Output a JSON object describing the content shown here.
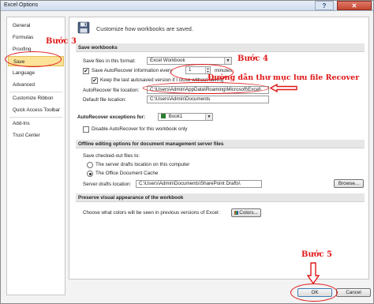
{
  "window": {
    "title": "Excel Options",
    "help_glyph": "?",
    "close_glyph": "✕"
  },
  "sidebar": {
    "items": [
      {
        "label": "General"
      },
      {
        "label": "Formulas"
      },
      {
        "label": "Proofing"
      },
      {
        "label": "Save",
        "selected": true
      },
      {
        "label": "Language"
      },
      {
        "label": "Advanced"
      },
      {
        "label": "Customize Ribbon"
      },
      {
        "label": "Quick Access Toolbar"
      },
      {
        "label": "Add-Ins"
      },
      {
        "label": "Trust Center"
      }
    ]
  },
  "header": {
    "text": "Customize how workbooks are saved.",
    "icon": "floppy-disk-icon"
  },
  "save_workbooks": {
    "section_title": "Save workbooks",
    "format_label": "Save files in this format:",
    "format_value": "Excel Workbook",
    "autorecover_label": "Save AutoRecover information every",
    "autorecover_checked": true,
    "autorecover_minutes": "1",
    "minutes_label": "minutes",
    "keep_last_label": "Keep the last autosaved version if I close without saving",
    "keep_last_checked": true,
    "autorecover_location_label": "AutoRecover file location:",
    "autorecover_location_value": "C:\\Users\\Admin\\AppData\\Roaming\\Microsoft\\Excel\\",
    "default_location_label": "Default file location:",
    "default_location_value": "C:\\Users\\Admin\\Documents"
  },
  "autorecover_exceptions": {
    "label": "AutoRecover exceptions for:",
    "workbook_value": "Book1",
    "disable_label": "Disable AutoRecover for this workbook only",
    "disable_checked": false
  },
  "offline_editing": {
    "section_title": "Offline editing options for document management server files",
    "checkout_label": "Save checked-out files to:",
    "option_server": "The server drafts location on this computer",
    "option_cache": "The Office Document Cache",
    "drafts_label": "Server drafts location:",
    "drafts_value": "C:\\Users\\Admin\\Documents\\SharePoint Drafts\\",
    "browse_label": "Browse..."
  },
  "preserve_visual": {
    "section_title": "Preserve visual appearance of the workbook",
    "colors_label": "Choose what colors will be seen in previous versions of Excel:",
    "colors_button": "Colors..."
  },
  "footer": {
    "ok_label": "OK",
    "cancel_label": "Cancel"
  },
  "annotations": {
    "step3": "Bước 3",
    "step4": "Bước 4",
    "step5": "Bước 5",
    "recover_path_note": "Đường dẫn thư mục lưu file Recover",
    "color": "#e01818"
  }
}
